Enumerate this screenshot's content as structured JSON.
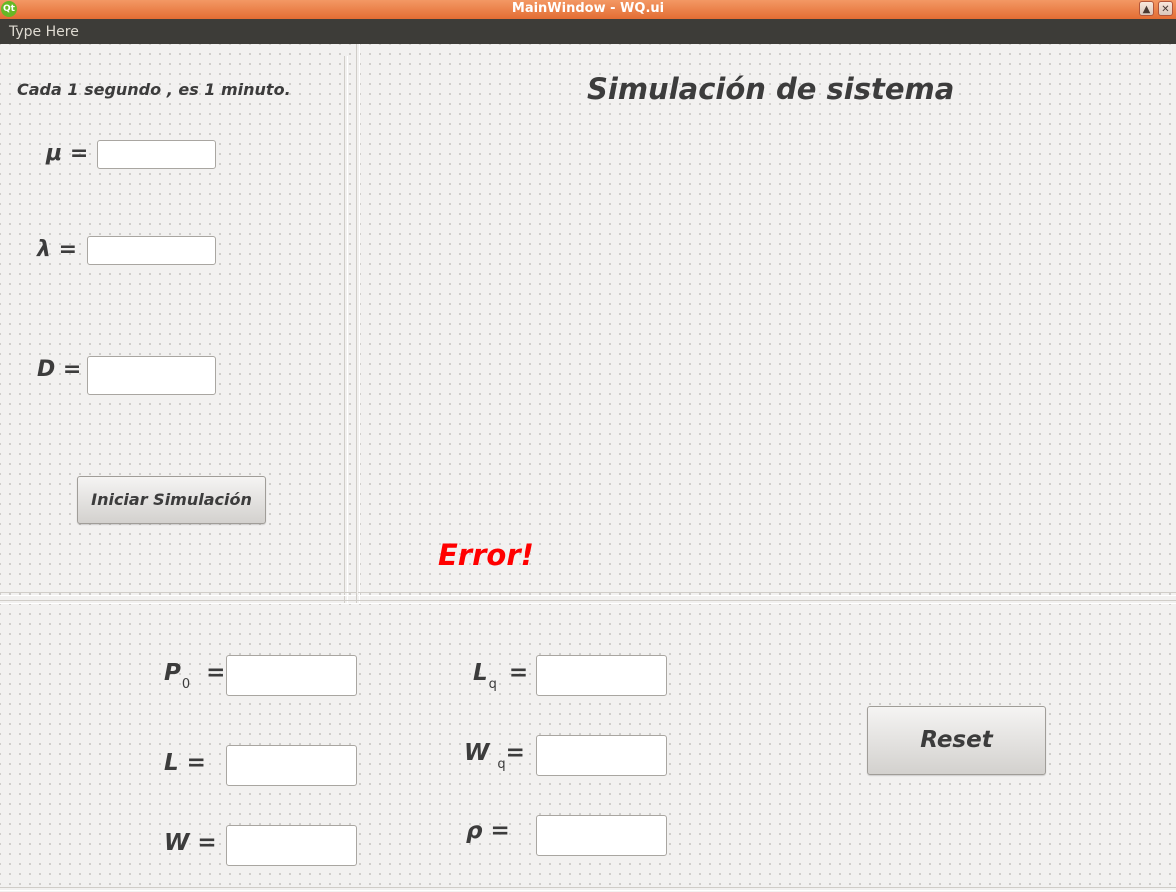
{
  "window": {
    "title": "MainWindow - WQ.ui",
    "logo_text": "Qt",
    "controls": {
      "maximize": "▲",
      "close": "✕"
    }
  },
  "menubar": {
    "item": "Type Here"
  },
  "left_panel": {
    "note": "Cada 1 segundo , es 1 minuto.",
    "mu_label": "μ =",
    "lambda_label": "λ =",
    "d_label": "D =",
    "mu_value": "",
    "lambda_value": "",
    "d_value": "",
    "start_button": "Iniciar Simulación"
  },
  "main_panel": {
    "title": "Simulación de sistema",
    "error_text": "Error!",
    "error_color": "#ff0000"
  },
  "results": {
    "p0_main": "P",
    "p0_sub": "0",
    "p0_eq": "=",
    "l_label": "L =",
    "w_label": "W  =",
    "lq_main": "L",
    "lq_sub": "q",
    "lq_eq": "=",
    "wq_main": "W",
    "wq_sub": "q",
    "wq_eq": "=",
    "rho_label": "ρ  =",
    "reset_button": "Reset",
    "values": {
      "p0": "",
      "l": "",
      "w": "",
      "lq": "",
      "wq": "",
      "rho": ""
    }
  },
  "colors": {
    "titlebar": "#e36d33",
    "menubar": "#3d3c38",
    "text": "#3c3c3c",
    "error": "#ff0000"
  }
}
